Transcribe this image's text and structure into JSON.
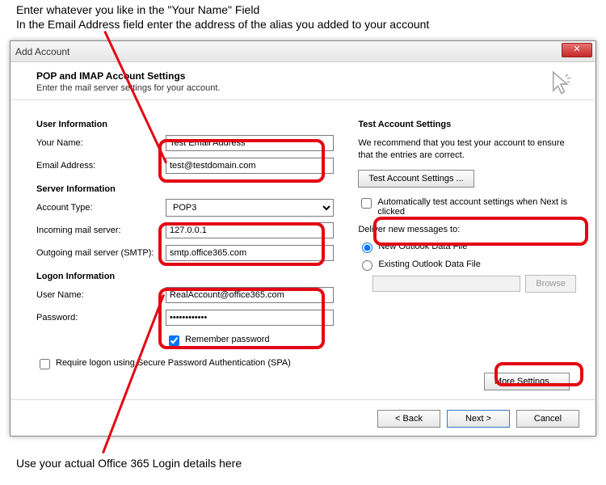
{
  "instructions": {
    "line1": "Enter whatever you like in the \"Your Name\" Field",
    "line2": "In the Email Address field enter the address of the alias you added to your account",
    "bottom": "Use your actual Office 365 Login details here"
  },
  "dialog": {
    "title": "Add Account",
    "header_title": "POP and IMAP Account Settings",
    "header_sub": "Enter the mail server settings for your account."
  },
  "left": {
    "user_info_head": "User Information",
    "your_name_label": "Your Name:",
    "your_name_value": "Test Email Address",
    "email_label": "Email Address:",
    "email_value": "test@testdomain.com",
    "server_info_head": "Server Information",
    "account_type_label": "Account Type:",
    "account_type_value": "POP3",
    "incoming_label": "Incoming mail server:",
    "incoming_value": "127.0.0.1",
    "outgoing_label": "Outgoing mail server (SMTP):",
    "outgoing_value": "smtp.office365.com",
    "logon_head": "Logon Information",
    "username_label": "User Name:",
    "username_value": "RealAccount@office365.com",
    "password_label": "Password:",
    "password_value": "************",
    "remember_label": "Remember password",
    "spa_label": "Require logon using Secure Password Authentication (SPA)"
  },
  "right": {
    "test_head": "Test Account Settings",
    "test_desc": "We recommend that you test your account to ensure that the entries are correct.",
    "test_btn": "Test Account Settings ...",
    "auto_test_label": "Automatically test account settings when Next is clicked",
    "deliver_head": "Deliver new messages to:",
    "radio_new": "New Outlook Data File",
    "radio_existing": "Existing Outlook Data File",
    "browse_btn": "Browse",
    "more_settings_btn": "More Settings ..."
  },
  "footer": {
    "back": "< Back",
    "next": "Next >",
    "cancel": "Cancel"
  }
}
